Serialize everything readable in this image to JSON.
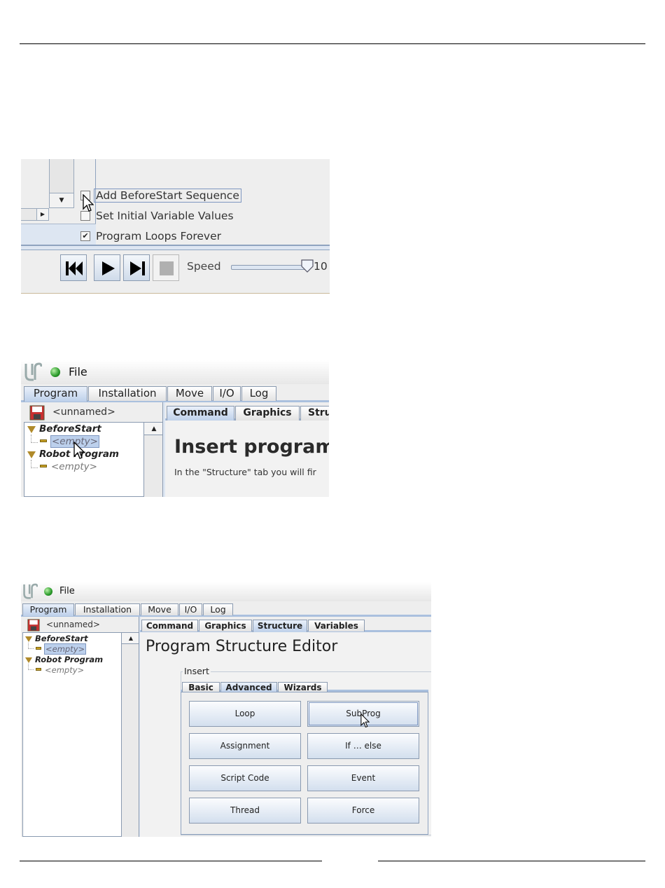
{
  "shot1": {
    "options": [
      {
        "label": "Add BeforeStart Sequence",
        "checked": false,
        "focused": true
      },
      {
        "label": "Set Initial Variable Values",
        "checked": false,
        "focused": false
      },
      {
        "label": "Program Loops Forever",
        "checked": true,
        "check_mark": "✔",
        "focused": false
      }
    ],
    "controls": {
      "buttons": [
        {
          "name": "skip-back-icon"
        },
        {
          "name": "play-icon"
        },
        {
          "name": "step-forward-icon"
        },
        {
          "name": "stop-icon",
          "enabled": false
        }
      ],
      "speed_label": "Speed",
      "speed_value": "10"
    }
  },
  "shot2": {
    "file_menu": "File",
    "tabs": [
      "Program",
      "Installation",
      "Move",
      "I/O",
      "Log"
    ],
    "active_tab": "Program",
    "program_name": "<unnamed>",
    "tree": {
      "before_start": "BeforeStart",
      "before_start_child": "<empty>",
      "robot_program": "Robot Program",
      "robot_program_child": "<empty>"
    },
    "subtabs": [
      "Command",
      "Graphics",
      "Stru"
    ],
    "active_subtab": "Command",
    "heading": "Insert program",
    "description": "In the \"Structure\" tab you will fir"
  },
  "shot3": {
    "file_menu": "File",
    "tabs": [
      "Program",
      "Installation",
      "Move",
      "I/O",
      "Log"
    ],
    "active_tab": "Program",
    "program_name": "<unnamed>",
    "tree": {
      "before_start": "BeforeStart",
      "before_start_child": "<empty>",
      "robot_program": "Robot Program",
      "robot_program_child": "<empty>"
    },
    "subtabs": [
      "Command",
      "Graphics",
      "Structure",
      "Variables"
    ],
    "active_subtab": "Structure",
    "heading": "Program Structure Editor",
    "insert_label": "Insert",
    "insert_tabs": [
      "Basic",
      "Advanced",
      "Wizards"
    ],
    "active_insert_tab": "Advanced",
    "buttons": [
      "Loop",
      "SubProg",
      "Assignment",
      "If … else",
      "Script Code",
      "Event",
      "Thread",
      "Force"
    ]
  },
  "colors": {
    "accent_blue": "#aac0de",
    "active_tab": "#bdd0ea",
    "status_green": "#2a9a2a",
    "tree_triangle": "#b08a2a"
  }
}
